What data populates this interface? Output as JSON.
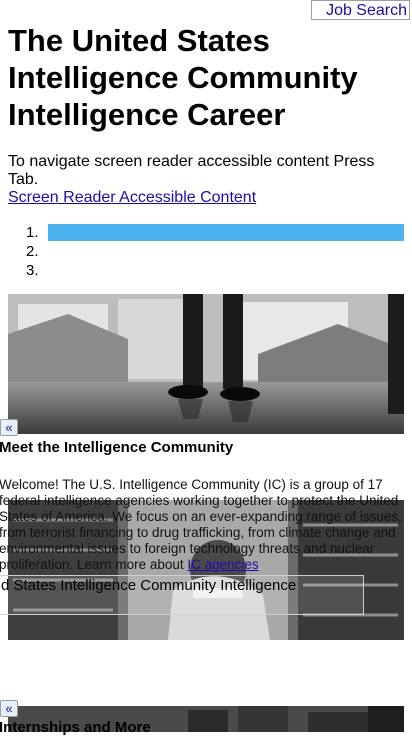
{
  "header": {
    "job_search": "Job Search"
  },
  "title": "The United States Intelligence Community Intelligence Career",
  "accessibility": {
    "instruction": "To navigate screen reader accessible content Press Tab.",
    "link": "Screen Reader Accessible Content"
  },
  "carousel": {
    "items": [
      {
        "num": "1."
      },
      {
        "num": "2."
      },
      {
        "num": "3."
      }
    ],
    "active_index": 0,
    "active_color": "#4db3f0"
  },
  "prev_icon": "«",
  "sections": [
    {
      "heading": "Meet the Intelligence Community",
      "body": "Welcome! The U.S. Intelligence Community (IC) is a group of 17 federal intelligence agencies working together to protect the United States of America. We focus on an ever-expanding range of issues, from terrorist financing to drug trafficking, from climate change and environmental issues to foreign technology threats and nuclear proliferation. Learn more about ",
      "link": "IC agencies",
      "caption": "d States Intelligence Community Intelligence"
    },
    {
      "heading": "Internships and More"
    }
  ],
  "link_color": "#1a0dab"
}
